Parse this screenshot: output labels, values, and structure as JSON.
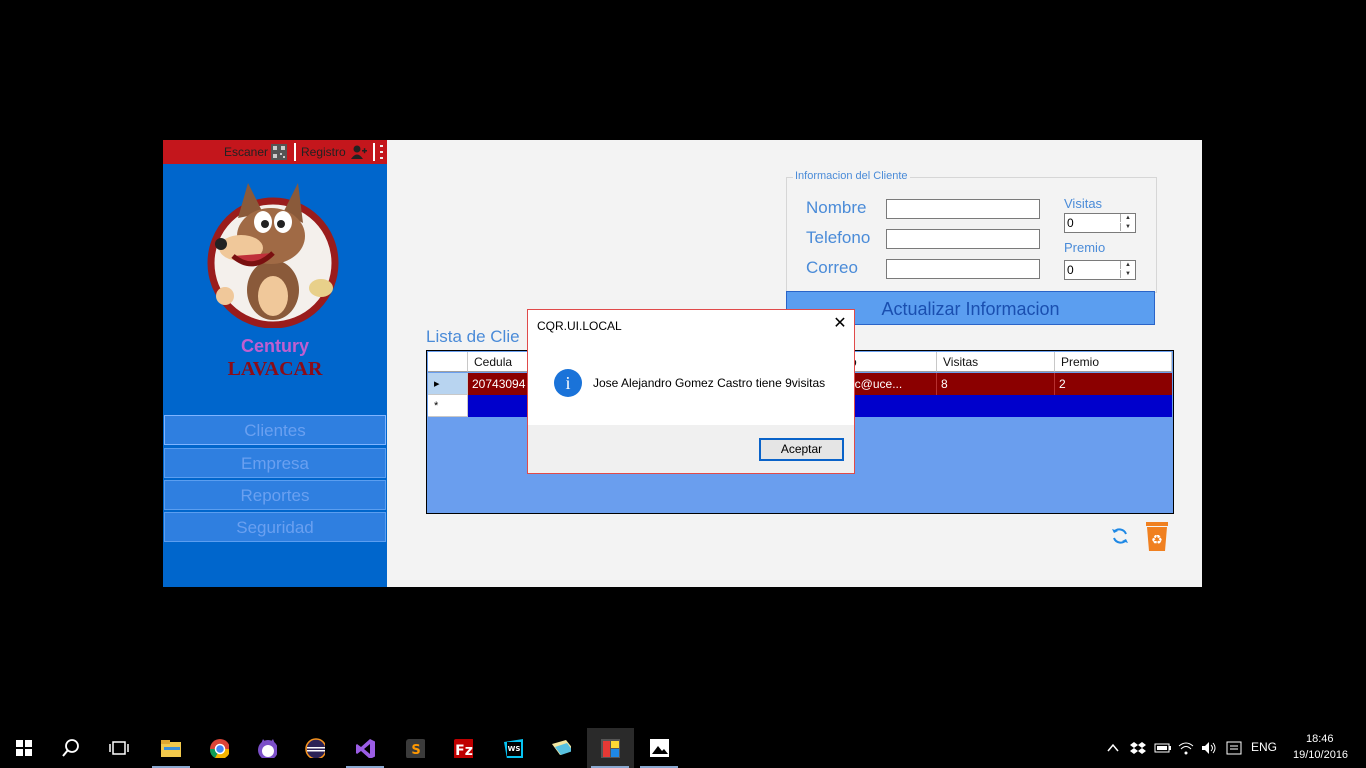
{
  "app": {
    "topbar": {
      "scan_label": "Escaner",
      "register_label": "Registro"
    },
    "brand": {
      "line1": "Century",
      "line2": "LAVACAR"
    },
    "nav": [
      "Clientes",
      "Empresa",
      "Reportes",
      "Seguridad"
    ],
    "info": {
      "legend": "Informacion del Cliente",
      "name_label": "Nombre",
      "phone_label": "Telefono",
      "email_label": "Correo",
      "name_value": "",
      "phone_value": "",
      "email_value": "",
      "visits_label": "Visitas",
      "visits_value": "0",
      "prize_label": "Premio",
      "prize_value": "0",
      "update_button": "Actualizar Informacion"
    },
    "list": {
      "title": "Lista de Clie",
      "columns": [
        "Cedula",
        "o",
        "Visitas",
        "Premio"
      ],
      "rows": [
        {
          "cedula": "20743094",
          "correo": "ezc@uce...",
          "visitas": "8",
          "premio": "2"
        }
      ],
      "new_row_marker": "*",
      "current_row_marker": "▸"
    }
  },
  "dialog": {
    "title": "CQR.UI.LOCAL",
    "message": "Jose Alejandro Gomez Castro tiene 9visitas",
    "ok_button": "Aceptar",
    "icon": "info-icon"
  },
  "taskbar": {
    "apps": [
      "start-icon",
      "search-icon",
      "task-view-icon",
      "file-explorer-icon",
      "chrome-icon",
      "cat-app-icon",
      "eclipse-icon",
      "visual-studio-icon",
      "sublime-icon",
      "filezilla-icon",
      "webstorm-icon",
      "folder-app-icon",
      "active-app-icon",
      "photos-icon"
    ],
    "language": "ENG",
    "time": "18:46",
    "date": "19/10/2016"
  },
  "colors": {
    "sidebar": "#0066cc",
    "topbar": "#c4161c",
    "selected_row": "#8b0000",
    "new_row": "#0000cc",
    "grid_bg": "#6a9eee",
    "accent_text": "#4a8bd8"
  }
}
